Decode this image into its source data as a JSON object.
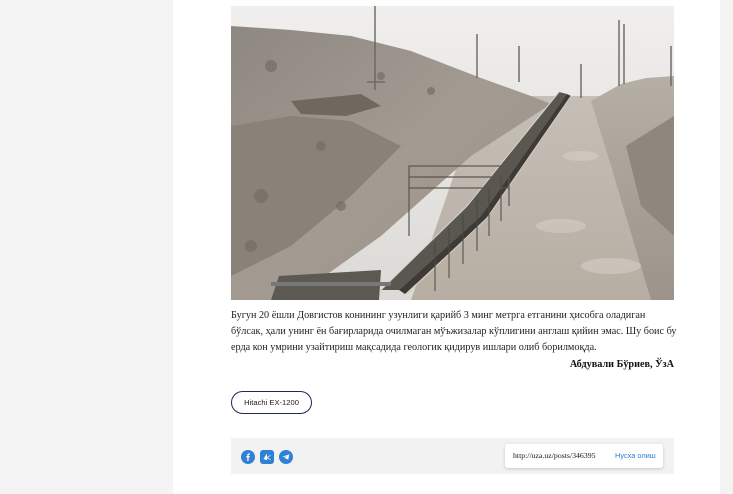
{
  "article": {
    "caption": "Бугун 20 ёшли Довгистов конининг узунлиги қарийб 3 минг метрга етганини ҳисобга оладиган бўлсак, ҳали унинг ён бағирларида очилмаган мўъжизалар кўплигини англаш қийин эмас. Шу боис бу ерда кон умрини узайтириш мақсадида геологик қидирув ишлари олиб борилмоқда.",
    "author": "Абдували Бўриев, ЎзА"
  },
  "tags": [
    "Hitachi EX-1200"
  ],
  "share": {
    "icons": [
      "facebook-icon",
      "vk-icon",
      "telegram-icon"
    ],
    "link_url": "http://uza.uz/posts/346395",
    "copy_label": "Нусха олиш",
    "accent_color": "#2f81d6"
  },
  "colors": {
    "tag_border": "#1d2b57",
    "page_bg": "#f4f4f4",
    "content_bg": "#ffffff"
  }
}
